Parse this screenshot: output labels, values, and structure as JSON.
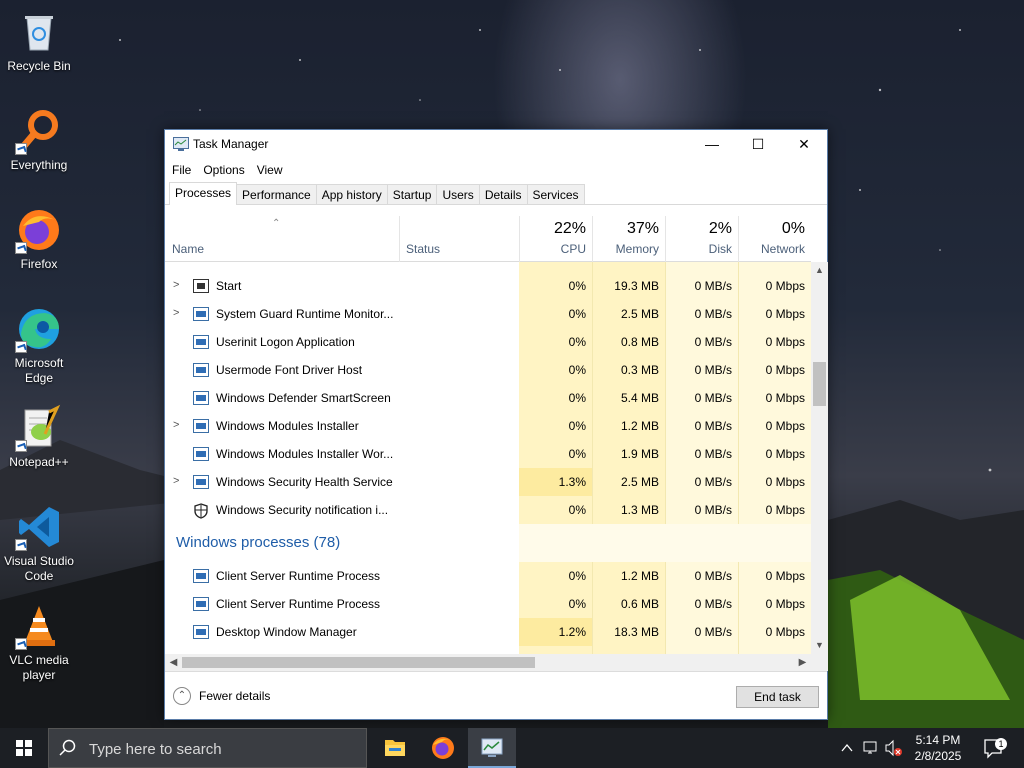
{
  "desktop": {
    "icons": [
      {
        "label": "Recycle Bin",
        "icon": "recycle-bin-icon"
      },
      {
        "label": "Everything",
        "icon": "everything-search-icon"
      },
      {
        "label": "Firefox",
        "icon": "firefox-icon"
      },
      {
        "label": "Microsoft Edge",
        "icon": "edge-icon"
      },
      {
        "label": "Notepad++",
        "icon": "notepadpp-icon"
      },
      {
        "label": "Visual Studio Code",
        "icon": "vscode-icon"
      },
      {
        "label": "VLC media player",
        "icon": "vlc-icon"
      }
    ]
  },
  "window": {
    "title": "Task Manager",
    "controls": {
      "minimize": "—",
      "maximize": "☐",
      "close": "✕"
    },
    "menu": [
      "File",
      "Options",
      "View"
    ],
    "tabs": [
      "Processes",
      "Performance",
      "App history",
      "Startup",
      "Users",
      "Details",
      "Services"
    ],
    "active_tab": "Processes",
    "columns": {
      "name": "Name",
      "status": "Status",
      "cpu": {
        "pct": "22%",
        "label": "CPU"
      },
      "memory": {
        "pct": "37%",
        "label": "Memory"
      },
      "disk": {
        "pct": "2%",
        "label": "Disk"
      },
      "network": {
        "pct": "0%",
        "label": "Network"
      }
    },
    "rows": [
      {
        "name": "Start",
        "expandable": true,
        "icon": "start-process-icon",
        "cpu": "0%",
        "memory": "19.3 MB",
        "disk": "0 MB/s",
        "network": "0 Mbps"
      },
      {
        "name": "System Guard Runtime Monitor...",
        "expandable": true,
        "icon": "process-icon",
        "cpu": "0%",
        "memory": "2.5 MB",
        "disk": "0 MB/s",
        "network": "0 Mbps"
      },
      {
        "name": "Userinit Logon Application",
        "expandable": false,
        "icon": "process-icon",
        "cpu": "0%",
        "memory": "0.8 MB",
        "disk": "0 MB/s",
        "network": "0 Mbps"
      },
      {
        "name": "Usermode Font Driver Host",
        "expandable": false,
        "icon": "process-icon",
        "cpu": "0%",
        "memory": "0.3 MB",
        "disk": "0 MB/s",
        "network": "0 Mbps"
      },
      {
        "name": "Windows Defender SmartScreen",
        "expandable": false,
        "icon": "process-icon",
        "cpu": "0%",
        "memory": "5.4 MB",
        "disk": "0 MB/s",
        "network": "0 Mbps"
      },
      {
        "name": "Windows Modules Installer",
        "expandable": true,
        "icon": "process-icon",
        "cpu": "0%",
        "memory": "1.2 MB",
        "disk": "0 MB/s",
        "network": "0 Mbps"
      },
      {
        "name": "Windows Modules Installer Wor...",
        "expandable": false,
        "icon": "process-icon",
        "cpu": "0%",
        "memory": "1.9 MB",
        "disk": "0 MB/s",
        "network": "0 Mbps"
      },
      {
        "name": "Windows Security Health Service",
        "expandable": true,
        "icon": "process-icon",
        "cpu": "1.3%",
        "memory": "2.5 MB",
        "disk": "0 MB/s",
        "network": "0 Mbps"
      },
      {
        "name": "Windows Security notification i...",
        "expandable": false,
        "icon": "shield-icon",
        "cpu": "0%",
        "memory": "1.3 MB",
        "disk": "0 MB/s",
        "network": "0 Mbps"
      }
    ],
    "group_label": "Windows processes (78)",
    "group_rows": [
      {
        "name": "Client Server Runtime Process",
        "icon": "process-icon",
        "cpu": "0%",
        "memory": "1.2 MB",
        "disk": "0 MB/s",
        "network": "0 Mbps"
      },
      {
        "name": "Client Server Runtime Process",
        "icon": "process-icon",
        "cpu": "0%",
        "memory": "0.6 MB",
        "disk": "0 MB/s",
        "network": "0 Mbps"
      },
      {
        "name": "Desktop Window Manager",
        "icon": "process-icon",
        "cpu": "1.2%",
        "memory": "18.3 MB",
        "disk": "0 MB/s",
        "network": "0 Mbps"
      }
    ],
    "footer": {
      "fewer_details": "Fewer details",
      "end_task": "End task"
    }
  },
  "taskbar": {
    "search_placeholder": "Type here to search",
    "apps": [
      "file-explorer-icon",
      "firefox-icon",
      "task-manager-icon"
    ],
    "clock": {
      "time": "5:14 PM",
      "date": "2/8/2025"
    },
    "notification_count": "1"
  },
  "colors": {
    "cpu_mem_bg": "#fff4c4",
    "disk_net_bg": "#fff9dc",
    "cpu_hot": "#fdeba0",
    "group_text": "#1f5da8",
    "taskbar": "#1c1f24"
  }
}
